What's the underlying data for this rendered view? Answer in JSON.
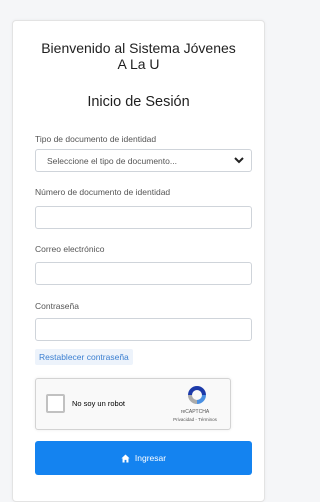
{
  "header": {
    "welcome_line1": "Bienvenido al Sistema Jóvenes",
    "welcome_line2": "A La U",
    "subtitle": "Inicio de Sesión"
  },
  "form": {
    "doc_type": {
      "label": "Tipo de documento de identidad",
      "selected": "Seleccione el tipo de documento..."
    },
    "doc_number": {
      "label": "Número de documento de identidad",
      "value": ""
    },
    "email": {
      "label": "Correo electrónico",
      "value": ""
    },
    "password": {
      "label": "Contraseña",
      "value": ""
    },
    "reset_link": "Restablecer contraseña",
    "captcha": {
      "label": "No soy un robot",
      "brand": "reCAPTCHA",
      "terms": "Privacidad - Términos"
    },
    "submit_label": "Ingresar"
  },
  "icons": [
    "chevron-down-icon",
    "recaptcha-logo-icon",
    "home-icon"
  ],
  "colors": {
    "primary": "#1483f0",
    "link": "#3b7fd1",
    "background": "#f5f6f8"
  }
}
